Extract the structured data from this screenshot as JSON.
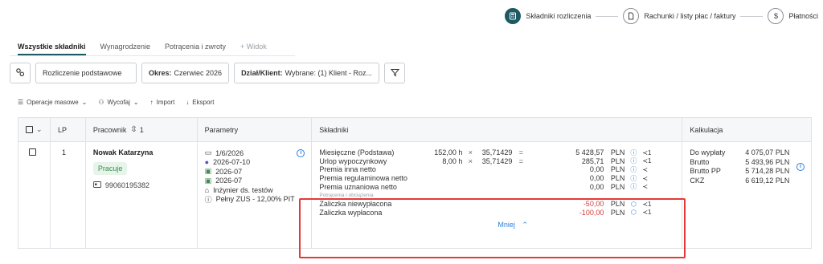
{
  "stepper": {
    "steps": [
      {
        "label": "Składniki rozliczenia",
        "active": true,
        "icon": "calculator-icon"
      },
      {
        "label": "Rachunki / listy płac / faktury",
        "active": false,
        "icon": "document-icon"
      },
      {
        "label": "Płatności",
        "active": false,
        "icon": "dollar-icon"
      }
    ]
  },
  "tabs": [
    {
      "label": "Wszystkie składniki",
      "active": true
    },
    {
      "label": "Wynagrodzenie",
      "active": false
    },
    {
      "label": "Potrącenia i zwroty",
      "active": false
    },
    {
      "label": "+ Widok",
      "active": false,
      "muted": true
    }
  ],
  "toolbar": {
    "calc_name": "Rozliczenie podstawowe",
    "period_label": "Okres:",
    "period_value": "Czerwiec 2026",
    "dept_label": "Dział/Klient:",
    "dept_value": "Wybrane: (1) Klient - Roz..."
  },
  "actions": {
    "bulk": "Operacje masowe",
    "withdraw": "Wycofaj",
    "import": "Import",
    "export": "Eksport"
  },
  "table": {
    "headers": {
      "lp": "LP",
      "employee": "Pracownik",
      "employee_sort_count": "1",
      "params": "Parametry",
      "components": "Składniki",
      "calc": "Kalkulacja"
    },
    "row": {
      "lp": "1",
      "employee_name": "Nowak Katarzyna",
      "status": "Pracuje",
      "employee_id": "99060195382",
      "params": [
        {
          "icon": "calendar-icon",
          "text": "1/6/2026"
        },
        {
          "icon": "clock-icon",
          "text": "2026-07-10"
        },
        {
          "icon": "file-green-icon",
          "text": "2026-07"
        },
        {
          "icon": "file-icon",
          "text": "2026-07"
        },
        {
          "icon": "briefcase-icon",
          "text": "Inżynier ds. testów"
        },
        {
          "icon": "info-icon",
          "text": "Pełny ZUS - 12,00% PIT"
        }
      ],
      "components": [
        {
          "name": "Miesięczne (Podstawa)",
          "hours": "152,00 h",
          "rate": "35,71429",
          "amount": "5 428,57",
          "currency": "PLN",
          "share": "1"
        },
        {
          "name": "Urlop wypoczynkowy",
          "hours": "8,00 h",
          "rate": "35,71429",
          "amount": "285,71",
          "currency": "PLN",
          "share": "1"
        },
        {
          "name": "Premia inna netto",
          "hours": "",
          "rate": "",
          "amount": "0,00",
          "currency": "PLN",
          "share": ""
        },
        {
          "name": "Premia regulaminowa netto",
          "hours": "",
          "rate": "",
          "amount": "0,00",
          "currency": "PLN",
          "share": ""
        },
        {
          "name": "Premia uznaniowa netto",
          "hours": "",
          "rate": "",
          "amount": "0,00",
          "currency": "PLN",
          "share": ""
        }
      ],
      "deductions_label": "Potrącenia i obciążenia",
      "deductions": [
        {
          "name": "Zaliczka niewypłacona",
          "amount": "-50,00",
          "currency": "PLN",
          "share": "1"
        },
        {
          "name": "Zaliczka wypłacona",
          "amount": "-100,00",
          "currency": "PLN",
          "share": "1"
        }
      ],
      "less_label": "Mniej",
      "calc": [
        {
          "name": "Do wypłaty",
          "value": "4 075,07 PLN"
        },
        {
          "name": "Brutto",
          "value": "5 493,96 PLN"
        },
        {
          "name": "Brutto PP",
          "value": "5 714,28 PLN"
        },
        {
          "name": "CKZ",
          "value": "6 619,12 PLN"
        }
      ]
    }
  },
  "colors": {
    "accent": "#1e5a63",
    "link": "#2d7fd8",
    "negative": "#d43a3a",
    "highlight": "#e53935"
  }
}
